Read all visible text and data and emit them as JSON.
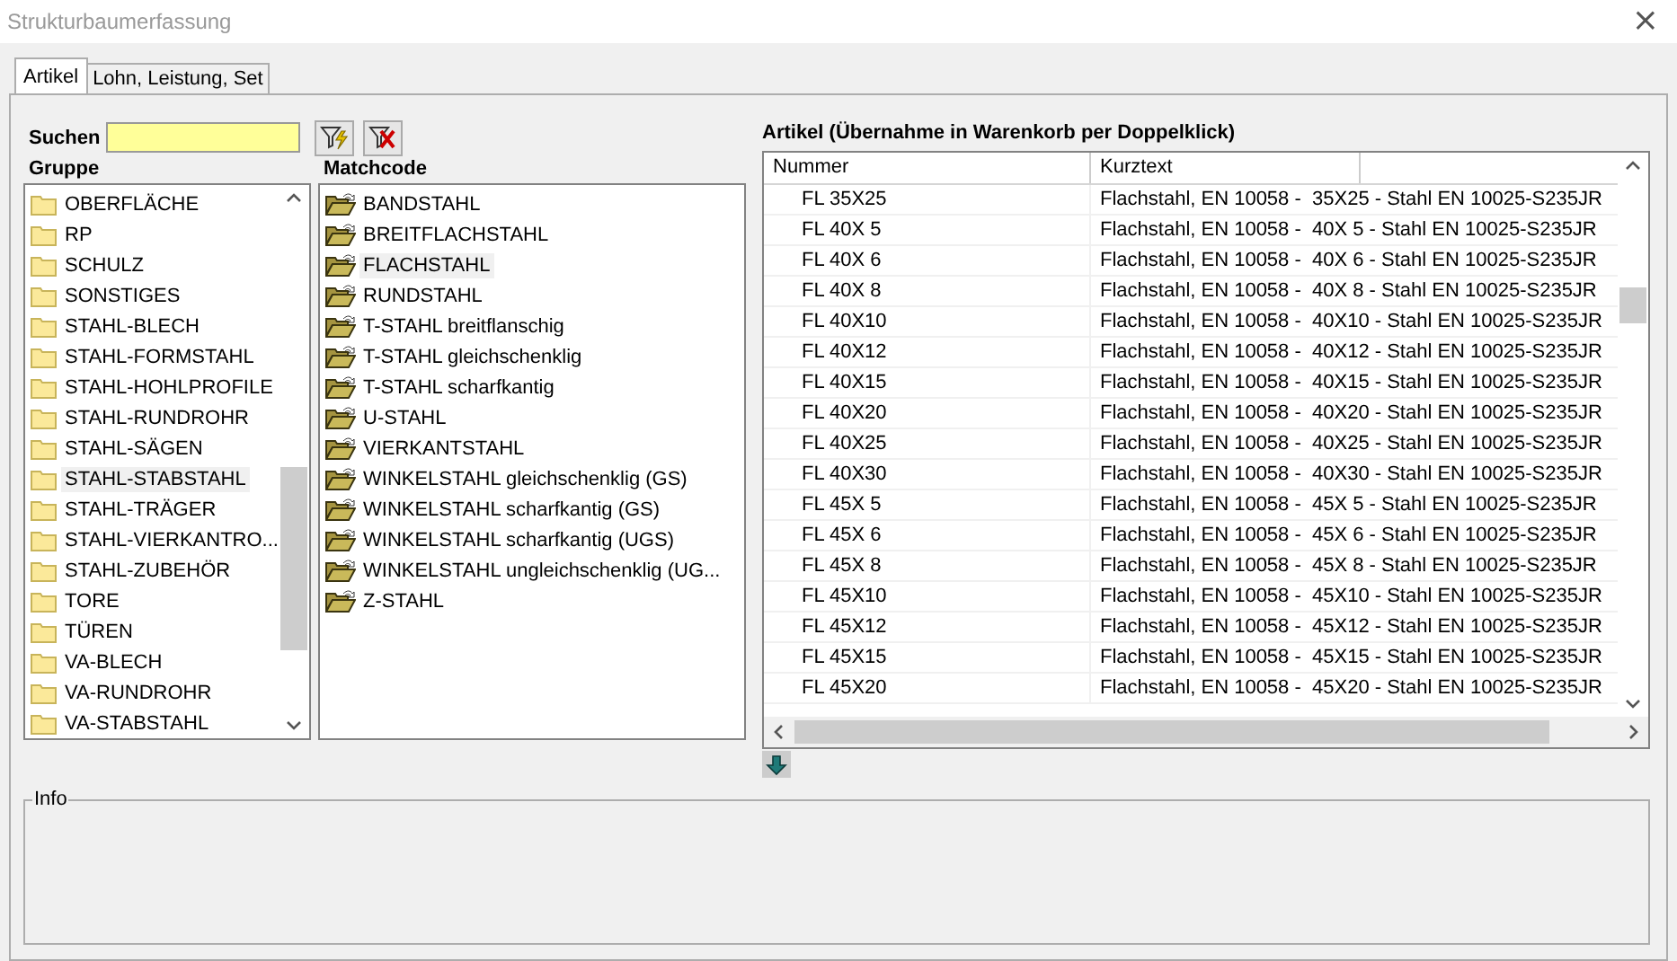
{
  "window": {
    "title": "Strukturbaumerfassung",
    "close": "×"
  },
  "tabs": [
    {
      "label": "Artikel",
      "selected": true
    },
    {
      "label": "Lohn, Leistung, Set",
      "selected": false
    }
  ],
  "search": {
    "label": "Suchen"
  },
  "gruppe": {
    "heading": "Gruppe",
    "items": [
      {
        "label": "OBERFLÄCHE",
        "selected": false
      },
      {
        "label": "RP",
        "selected": false
      },
      {
        "label": "SCHULZ",
        "selected": false
      },
      {
        "label": "SONSTIGES",
        "selected": false
      },
      {
        "label": "STAHL-BLECH",
        "selected": false
      },
      {
        "label": "STAHL-FORMSTAHL",
        "selected": false
      },
      {
        "label": "STAHL-HOHLPROFILE",
        "selected": false
      },
      {
        "label": "STAHL-RUNDROHR",
        "selected": false
      },
      {
        "label": "STAHL-SÄGEN",
        "selected": false
      },
      {
        "label": "STAHL-STABSTAHL",
        "selected": true
      },
      {
        "label": "STAHL-TRÄGER",
        "selected": false
      },
      {
        "label": "STAHL-VIERKANTRO...",
        "selected": false
      },
      {
        "label": "STAHL-ZUBEHÖR",
        "selected": false
      },
      {
        "label": "TORE",
        "selected": false
      },
      {
        "label": "TÜREN",
        "selected": false
      },
      {
        "label": "VA-BLECH",
        "selected": false
      },
      {
        "label": "VA-RUNDROHR",
        "selected": false
      },
      {
        "label": "VA-STABSTAHL",
        "selected": false
      }
    ]
  },
  "matchcode": {
    "heading": "Matchcode",
    "items": [
      {
        "label": "BANDSTAHL",
        "selected": false
      },
      {
        "label": "BREITFLACHSTAHL",
        "selected": false
      },
      {
        "label": "FLACHSTAHL",
        "selected": true
      },
      {
        "label": "RUNDSTAHL",
        "selected": false
      },
      {
        "label": "T-STAHL breitflanschig",
        "selected": false
      },
      {
        "label": "T-STAHL gleichschenklig",
        "selected": false
      },
      {
        "label": "T-STAHL scharfkantig",
        "selected": false
      },
      {
        "label": "U-STAHL",
        "selected": false
      },
      {
        "label": "VIERKANTSTAHL",
        "selected": false
      },
      {
        "label": "WINKELSTAHL gleichschenklig (GS)",
        "selected": false
      },
      {
        "label": "WINKELSTAHL scharfkantig (GS)",
        "selected": false
      },
      {
        "label": "WINKELSTAHL scharfkantig (UGS)",
        "selected": false
      },
      {
        "label": "WINKELSTAHL ungleichschenklig (UG...",
        "selected": false
      },
      {
        "label": "Z-STAHL",
        "selected": false
      }
    ]
  },
  "table": {
    "title": "Artikel (Übernahme in Warenkorb per Doppelklick)",
    "columns": [
      "Nummer",
      "Kurztext"
    ],
    "rows": [
      [
        "FL 35X25",
        "Flachstahl, EN 10058 -  35X25 - Stahl EN 10025-S235JR"
      ],
      [
        "FL 40X 5",
        "Flachstahl, EN 10058 -  40X 5 - Stahl EN 10025-S235JR"
      ],
      [
        "FL 40X 6",
        "Flachstahl, EN 10058 -  40X 6 - Stahl EN 10025-S235JR"
      ],
      [
        "FL 40X 8",
        "Flachstahl, EN 10058 -  40X 8 - Stahl EN 10025-S235JR"
      ],
      [
        "FL 40X10",
        "Flachstahl, EN 10058 -  40X10 - Stahl EN 10025-S235JR"
      ],
      [
        "FL 40X12",
        "Flachstahl, EN 10058 -  40X12 - Stahl EN 10025-S235JR"
      ],
      [
        "FL 40X15",
        "Flachstahl, EN 10058 -  40X15 - Stahl EN 10025-S235JR"
      ],
      [
        "FL 40X20",
        "Flachstahl, EN 10058 -  40X20 - Stahl EN 10025-S235JR"
      ],
      [
        "FL 40X25",
        "Flachstahl, EN 10058 -  40X25 - Stahl EN 10025-S235JR"
      ],
      [
        "FL 40X30",
        "Flachstahl, EN 10058 -  40X30 - Stahl EN 10025-S235JR"
      ],
      [
        "FL 45X 5",
        "Flachstahl, EN 10058 -  45X 5 - Stahl EN 10025-S235JR"
      ],
      [
        "FL 45X 6",
        "Flachstahl, EN 10058 -  45X 6 - Stahl EN 10025-S235JR"
      ],
      [
        "FL 45X 8",
        "Flachstahl, EN 10058 -  45X 8 - Stahl EN 10025-S235JR"
      ],
      [
        "FL 45X10",
        "Flachstahl, EN 10058 -  45X10 - Stahl EN 10025-S235JR"
      ],
      [
        "FL 45X12",
        "Flachstahl, EN 10058 -  45X12 - Stahl EN 10025-S235JR"
      ],
      [
        "FL 45X15",
        "Flachstahl, EN 10058 -  45X15 - Stahl EN 10025-S235JR"
      ],
      [
        "FL 45X20",
        "Flachstahl, EN 10058 -  45X20 - Stahl EN 10025-S235JR"
      ]
    ]
  },
  "info": {
    "label": "Info"
  }
}
